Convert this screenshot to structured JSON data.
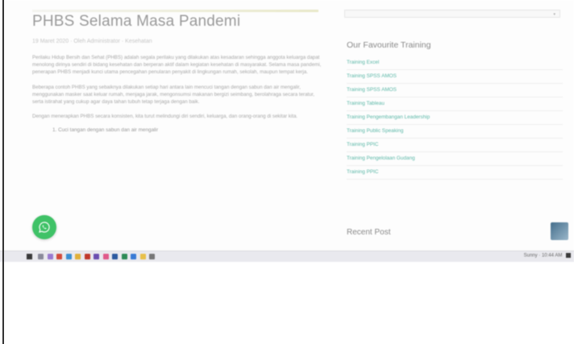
{
  "article": {
    "title": "PHBS Selama Masa Pandemi",
    "meta": "19 Maret 2020 · Oleh Administrator · Kesehatan",
    "paragraphs": [
      "Perilaku Hidup Bersih dan Sehat (PHBS) adalah segala perilaku yang dilakukan atas kesadaran sehingga anggota keluarga dapat menolong dirinya sendiri di bidang kesehatan dan berperan aktif dalam kegiatan kesehatan di masyarakat. Selama masa pandemi, penerapan PHBS menjadi kunci utama pencegahan penularan penyakit di lingkungan rumah, sekolah, maupun tempat kerja.",
      "Beberapa contoh PHBS yang sebaiknya dilakukan setiap hari antara lain mencuci tangan dengan sabun dan air mengalir, menggunakan masker saat keluar rumah, menjaga jarak, mengonsumsi makanan bergizi seimbang, berolahraga secara teratur, serta istirahat yang cukup agar daya tahan tubuh tetap terjaga dengan baik.",
      "Dengan menerapkan PHBS secara konsisten, kita turut melindungi diri sendiri, keluarga, dan orang-orang di sekitar kita."
    ],
    "list_line": "1. Cuci tangan dengan sabun dan air mengalir"
  },
  "search": {
    "caret": "▾"
  },
  "sidebar": {
    "heading": "Our Favourite Training",
    "items": [
      "Training Excel",
      "Training SPSS AMOS",
      "Training SPSS AMOS",
      "Training Tableau",
      "Training Pengembangan Leadership",
      "Training Public Speaking",
      "Training PPIC",
      "Training Pengelolaan Gudang",
      "Training PPIC"
    ]
  },
  "recent": {
    "heading": "Recent Post"
  },
  "tray": {
    "text": "Sunny · 10:44 AM"
  },
  "taskbar_icons": [
    {
      "name": "search-icon",
      "color": "#8a8a9a"
    },
    {
      "name": "task-view-icon",
      "color": "#9a7ad0"
    },
    {
      "name": "chrome-icon",
      "color": "#d24b3c"
    },
    {
      "name": "edge-icon",
      "color": "#3c8fd2"
    },
    {
      "name": "explorer-icon",
      "color": "#e0b03a"
    },
    {
      "name": "media-icon",
      "color": "#c0392b"
    },
    {
      "name": "store-icon",
      "color": "#6b4fb0"
    },
    {
      "name": "mail-icon",
      "color": "#e05a8a"
    },
    {
      "name": "word-icon",
      "color": "#2c5aa0"
    },
    {
      "name": "excel-icon",
      "color": "#2e8b57"
    },
    {
      "name": "vscode-icon",
      "color": "#3a7bd5"
    },
    {
      "name": "folder-icon",
      "color": "#e8c04a"
    },
    {
      "name": "settings-icon",
      "color": "#777777"
    }
  ]
}
